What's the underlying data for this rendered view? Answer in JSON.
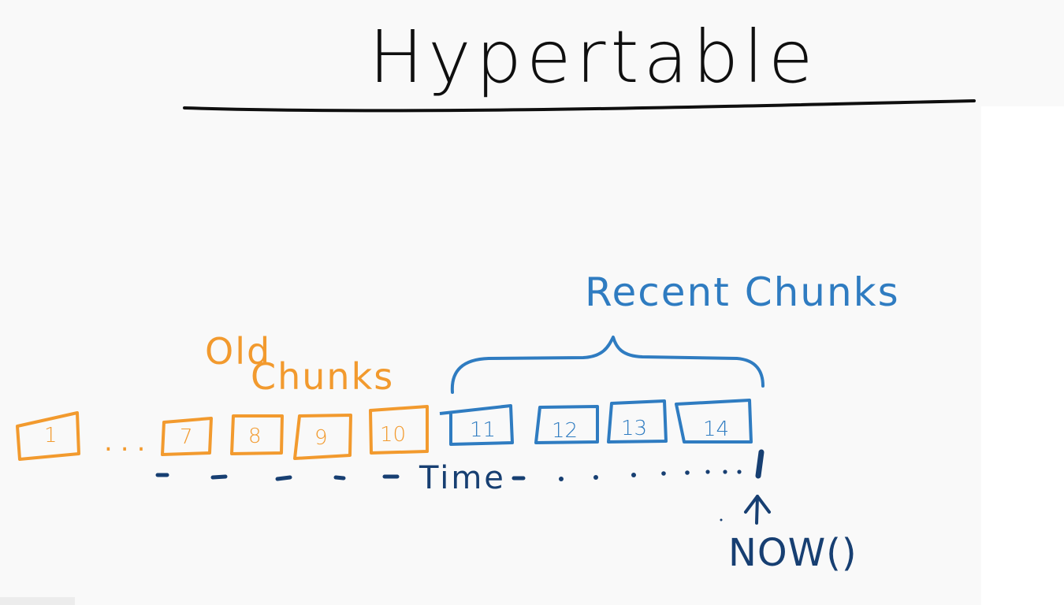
{
  "title": "Hypertable",
  "labels": {
    "old_line1": "Old",
    "old_line2": "Chunks",
    "recent": "Recent Chunks",
    "ellipsis": "...",
    "time": "Time",
    "now": "NOW()"
  },
  "old_chunks": [
    "1",
    "7",
    "8",
    "9",
    "10"
  ],
  "recent_chunks": [
    "11",
    "12",
    "13",
    "14"
  ],
  "colors": {
    "old": "#f29a2e",
    "recent": "#2f7cc1",
    "time": "#173f72",
    "title": "#0f0f0f"
  }
}
